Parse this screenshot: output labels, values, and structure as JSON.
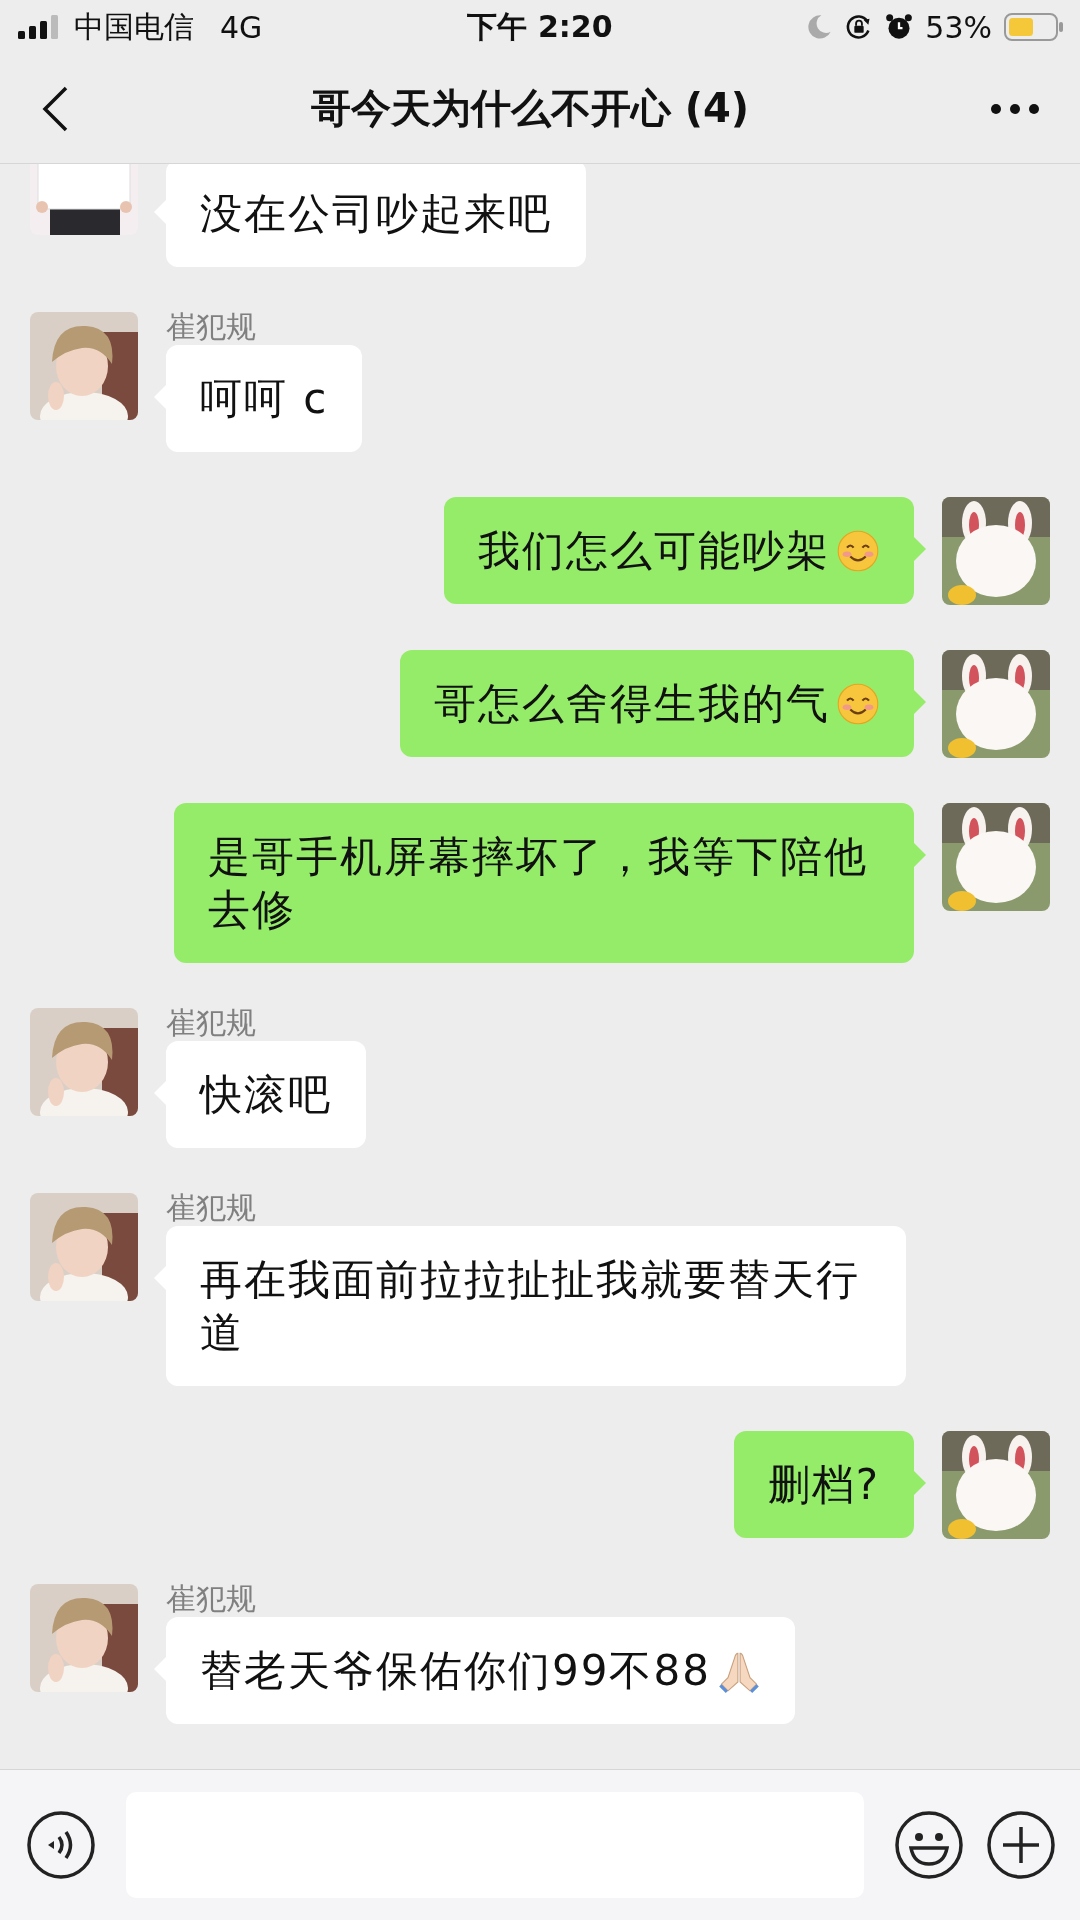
{
  "status_bar": {
    "carrier": "中国电信",
    "network": "4G",
    "time": "下午 2:20",
    "battery": "53%"
  },
  "header": {
    "title": "哥今天为什么不开心 (4)"
  },
  "messages": [
    {
      "outgoing": false,
      "kind": "plain",
      "text": "没在公司吵起来吧"
    },
    {
      "outgoing": false,
      "kind": "plain",
      "sender": "崔犯规",
      "text": "呵呵 c"
    },
    {
      "outgoing": true,
      "kind": "smile",
      "text": "我们怎么可能吵架"
    },
    {
      "outgoing": true,
      "kind": "smile",
      "text": "哥怎么舍得生我的气"
    },
    {
      "outgoing": true,
      "kind": "plain",
      "text": "是哥手机屏幕摔坏了，我等下陪他去修"
    },
    {
      "outgoing": false,
      "kind": "plain",
      "sender": "崔犯规",
      "text": "快滚吧"
    },
    {
      "outgoing": false,
      "kind": "plain",
      "sender": "崔犯规",
      "text": "再在我面前拉拉扯扯我就要替天行道"
    },
    {
      "outgoing": true,
      "kind": "plain",
      "text": "删档?"
    },
    {
      "outgoing": false,
      "kind": "pray",
      "sender": "崔犯规",
      "text": "替老天爷保佑你们99不88"
    }
  ]
}
